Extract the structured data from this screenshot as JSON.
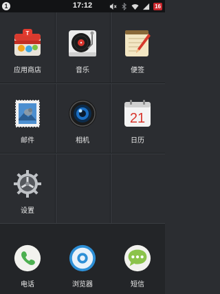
{
  "status_bar": {
    "notification_count": "1",
    "time": "17:12",
    "battery_level": "16",
    "icons": [
      "mute-icon",
      "bluetooth-icon",
      "wifi-icon",
      "signal-icon"
    ]
  },
  "apps": [
    {
      "label": "应用商店",
      "icon": "app-store-icon"
    },
    {
      "label": "音乐",
      "icon": "music-icon"
    },
    {
      "label": "便签",
      "icon": "notes-icon"
    },
    {
      "label": "邮件",
      "icon": "mail-icon"
    },
    {
      "label": "相机",
      "icon": "camera-icon"
    },
    {
      "label": "日历",
      "icon": "calendar-icon",
      "badge_text": "21"
    },
    {
      "label": "设置",
      "icon": "settings-icon"
    }
  ],
  "dock": [
    {
      "label": "电话",
      "icon": "phone-icon"
    },
    {
      "label": "浏览器",
      "icon": "browser-icon"
    },
    {
      "label": "短信",
      "icon": "messages-icon"
    }
  ],
  "colors": {
    "background": "#2b2d31",
    "status_bar": "#121315",
    "battery_low": "#c8262c",
    "dock": "#232528"
  }
}
